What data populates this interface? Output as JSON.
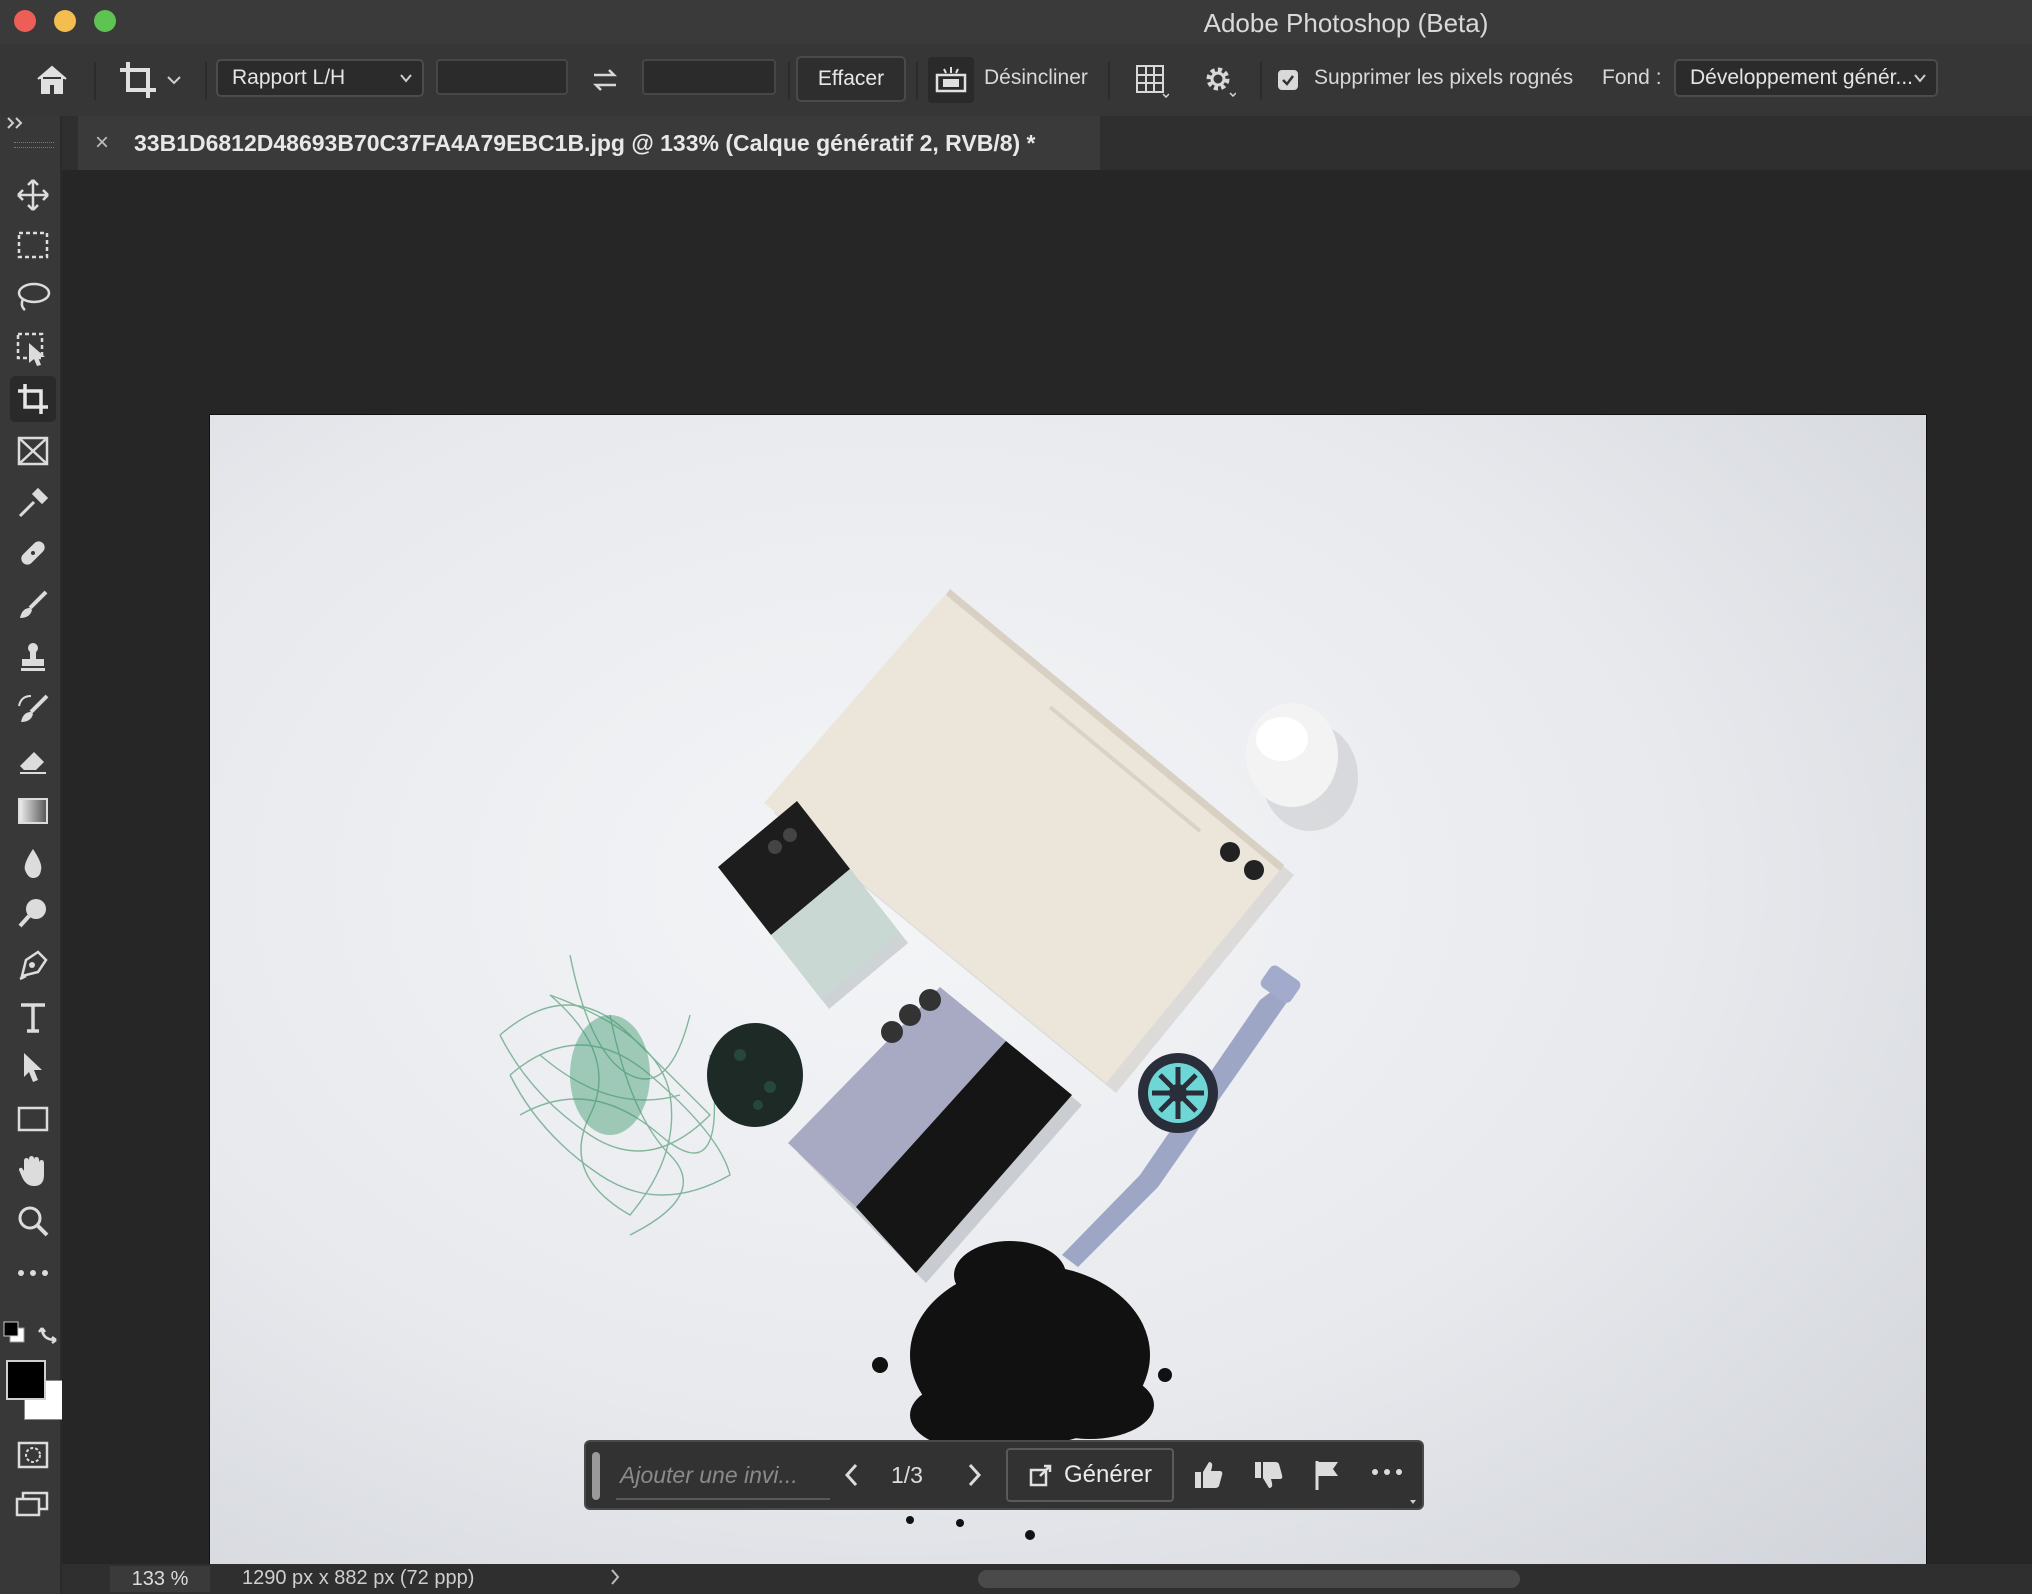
{
  "app": {
    "title": "Adobe Photoshop (Beta)"
  },
  "options_bar": {
    "ratio_label": "Rapport L/H",
    "width_value": "",
    "height_value": "",
    "clear_label": "Effacer",
    "straighten_label": "Désincliner",
    "delete_pixels_label": "Supprimer les pixels rognés",
    "delete_pixels_checked": true,
    "fill_label": "Fond :",
    "fill_value": "Développement génér..."
  },
  "document": {
    "tab_close": "×",
    "tab_title": "33B1D6812D48693B70C37FA4A79EBC1B.jpg @ 133% (Calque génératif 2, RVB/8) *"
  },
  "taskbar": {
    "prompt_placeholder": "Ajouter une invi...",
    "counter": "1/3",
    "generate_label": "Générer"
  },
  "status": {
    "zoom": "133 %",
    "doc_size": "1290 px x 882 px (72 ppp)"
  },
  "colors": {
    "accent_teal": "#6fd6d6",
    "foreground": "#000000",
    "background": "#ffffff"
  }
}
